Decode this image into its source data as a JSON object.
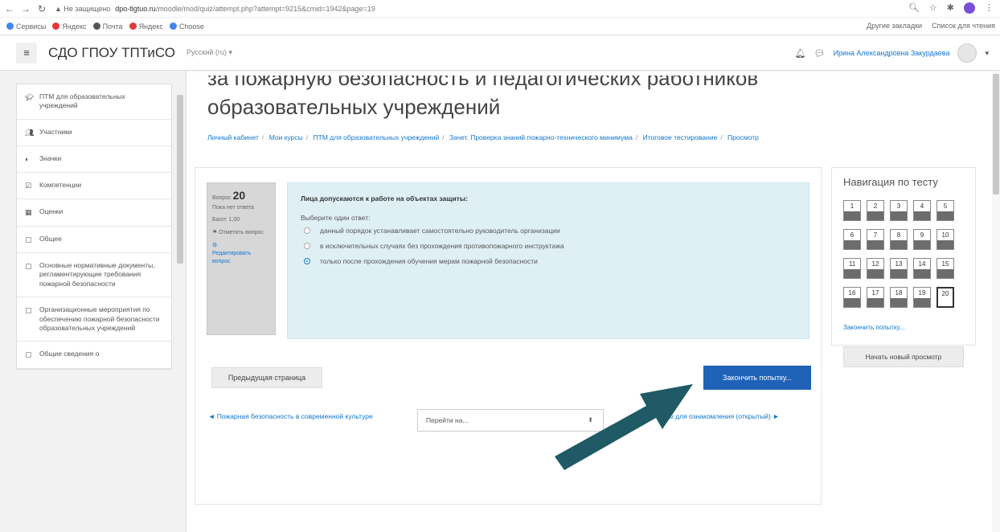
{
  "browser": {
    "security_warning": "▲ Не защищено",
    "url_host": "dpo-tlgtuo.ru",
    "url_path": "/moodle/mod/quiz/attempt.php?attempt=9215&cmid=1942&page=19",
    "bookmarks": [
      {
        "label": "Сервисы",
        "color": "#4285f4"
      },
      {
        "label": "Яндекс",
        "color": "#e53935"
      },
      {
        "label": "Почта",
        "color": "#555555"
      },
      {
        "label": "Яндекс",
        "color": "#e53935"
      },
      {
        "label": "Choose",
        "color": "#4285f4"
      }
    ],
    "bookmarks_right": [
      "Другие закладки",
      "Список для чтения"
    ]
  },
  "navbar": {
    "site_name": "СДО ГПОУ ТПТиСО",
    "language": "Русский (ru) ▾",
    "user_name": "Ирина Александровна Закурдаева"
  },
  "sidebar": {
    "items": [
      {
        "icon": "graduation-cap-icon",
        "glyph": "🎓",
        "label": "ПТМ для образовательных учреждений"
      },
      {
        "icon": "users-icon",
        "glyph": "👥",
        "label": "Участники"
      },
      {
        "icon": "badge-icon",
        "glyph": "◐",
        "label": "Значки"
      },
      {
        "icon": "competency-icon",
        "glyph": "☑",
        "label": "Компетенции"
      },
      {
        "icon": "grades-icon",
        "glyph": "▦",
        "label": "Оценки"
      },
      {
        "icon": "folder-icon",
        "glyph": "▢",
        "label": "Общее"
      },
      {
        "icon": "folder-icon",
        "glyph": "▢",
        "label": "Основные нормативные документы, регламентирующие требования пожарной безопасности"
      },
      {
        "icon": "folder-icon",
        "glyph": "▢",
        "label": "Организационные мероприятия по обеспечению пожарной безопасности образовательных учреждений"
      },
      {
        "icon": "folder-icon",
        "glyph": "▢",
        "label": "Общие сведения о"
      }
    ]
  },
  "page": {
    "title_line1": "за пожарную безопасность и педагогических работников",
    "title_line2": "образовательных учреждений",
    "breadcrumbs": [
      "Личный кабинет",
      "Мои курсы",
      "ПТМ для образовательных учреждений",
      "Зачет. Проверка знаний пожарно-технического минимума",
      "Итоговое тестирование",
      "Просмотр"
    ]
  },
  "question": {
    "label": "Вопрос",
    "number": "20",
    "status": "Пока нет ответа",
    "mark": "Балл: 1,00",
    "flag": "Отметить вопрос",
    "edit": "Редактировать вопрос",
    "text": "Лица допускаются к работе на объектах защиты:",
    "prompt": "Выберите один ответ:",
    "options": [
      {
        "text": "данный порядок устанавливает самостоятельно руководитель организации",
        "selected": false
      },
      {
        "text": "в исключительных случаях без прохождения противопожарного инструктажа",
        "selected": false
      },
      {
        "text": "только после прохождения обучения мерам пожарной безопасности",
        "selected": true
      }
    ]
  },
  "actions": {
    "prev_page": "Предыдущая страница",
    "finish": "Закончить попытку...",
    "prev_link": "◄ Пожарная безопасность в современной культуре",
    "jump_placeholder": "Перейти на...",
    "next_link": "Вопросы для ознакомления (открытый) ►"
  },
  "quiz_nav": {
    "title": "Навигация по тесту",
    "questions": [
      "1",
      "2",
      "3",
      "4",
      "5",
      "6",
      "7",
      "8",
      "9",
      "10",
      "11",
      "12",
      "13",
      "14",
      "15",
      "16",
      "17",
      "18",
      "19",
      "20"
    ],
    "current": "20",
    "finish_link": "Закончить попытку...",
    "new_preview": "Начать новый просмотр"
  },
  "colors": {
    "accent": "#1177d1",
    "primary_button": "#1f62b8",
    "answer_bg": "#dff0f5",
    "arrow": "#1f5a66"
  }
}
